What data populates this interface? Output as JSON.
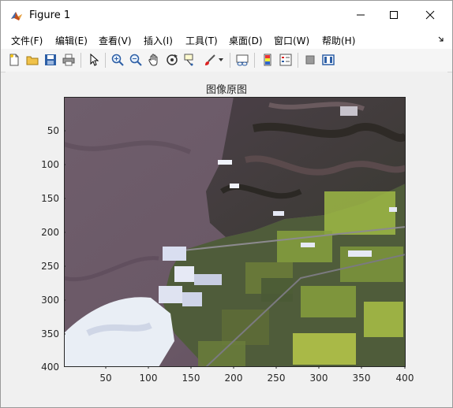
{
  "window": {
    "title": "Figure 1",
    "minimize_icon": "minimize-icon",
    "maximize_icon": "maximize-icon",
    "close_icon": "close-icon"
  },
  "menu": {
    "items": [
      {
        "label": "文件(F)"
      },
      {
        "label": "编辑(E)"
      },
      {
        "label": "查看(V)"
      },
      {
        "label": "插入(I)"
      },
      {
        "label": "工具(T)"
      },
      {
        "label": "桌面(D)"
      },
      {
        "label": "窗口(W)"
      },
      {
        "label": "帮助(H)"
      }
    ]
  },
  "toolbar": {
    "buttons": [
      "new-figure-icon",
      "open-file-icon",
      "save-icon",
      "print-icon",
      "pointer-icon",
      "zoom-in-icon",
      "zoom-out-icon",
      "pan-hand-icon",
      "rotate-3d-icon",
      "data-cursor-icon",
      "brush-icon",
      "brush-dropdown-icon",
      "link-plot-icon",
      "colorbar-icon",
      "legend-icon",
      "hide-plot-tools-icon",
      "show-plot-tools-icon"
    ]
  },
  "axes": {
    "title": "图像原图",
    "y_ticks": [
      "50",
      "100",
      "150",
      "200",
      "250",
      "300",
      "350",
      "400"
    ],
    "x_ticks": [
      "50",
      "100",
      "150",
      "200",
      "250",
      "300",
      "350",
      "400"
    ],
    "image_content": "satellite-image"
  }
}
